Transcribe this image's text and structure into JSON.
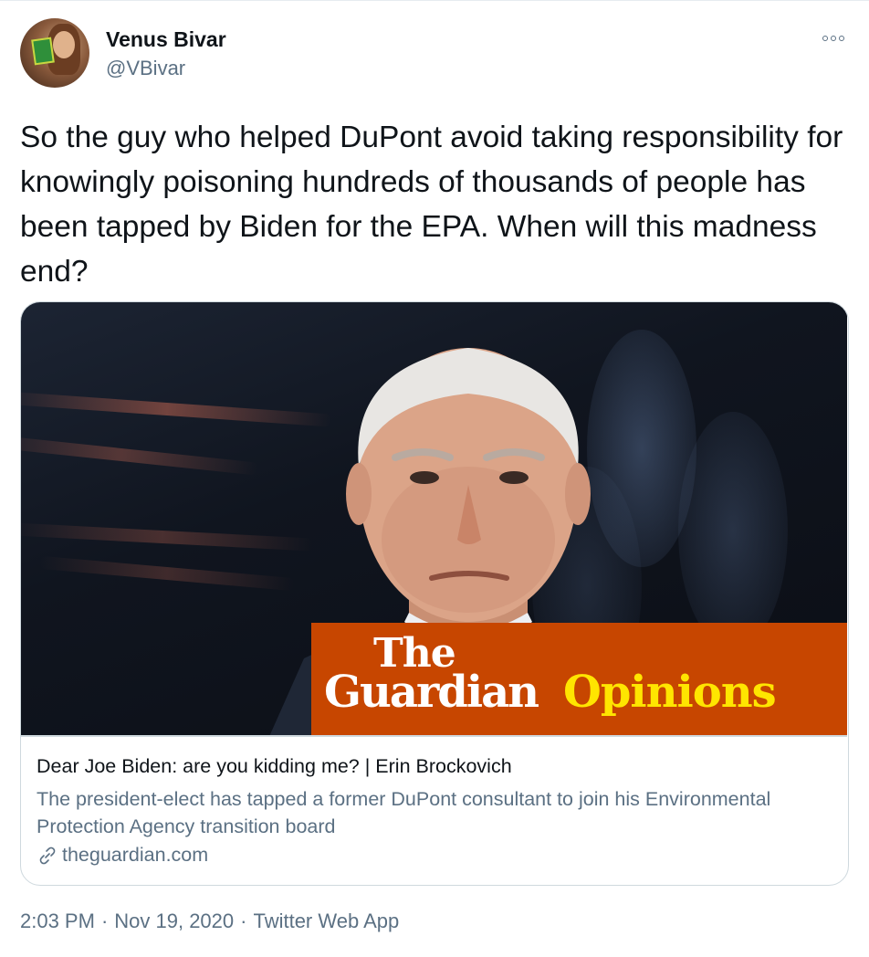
{
  "tweet": {
    "author": {
      "name": "Venus Bivar",
      "handle": "@VBivar"
    },
    "text": "So the guy who helped DuPont avoid taking responsibility for knowingly poisoning hundreds of thousands of people has been tapped by Biden for the EPA. When will this madness end?",
    "more_icon": "more-horizontal-icon",
    "card": {
      "image_brand": {
        "line1": "The",
        "line2": "Guardian",
        "line2_suffix": "Opinions"
      },
      "title": "Dear Joe Biden: are you kidding me? | Erin Brockovich",
      "description": "The president-elect has tapped a former DuPont consultant to join his Environmental Protection Agency transition board",
      "domain": "theguardian.com",
      "domain_icon": "link-icon"
    },
    "meta": {
      "time": "2:03 PM",
      "separator": "·",
      "date": "Nov 19, 2020",
      "source": "Twitter Web App"
    }
  },
  "colors": {
    "text_primary": "#0f1419",
    "text_secondary": "#5b7083",
    "card_border": "#cfd9de",
    "guardian_orange": "#c74600",
    "guardian_yellow": "#ffe500"
  }
}
